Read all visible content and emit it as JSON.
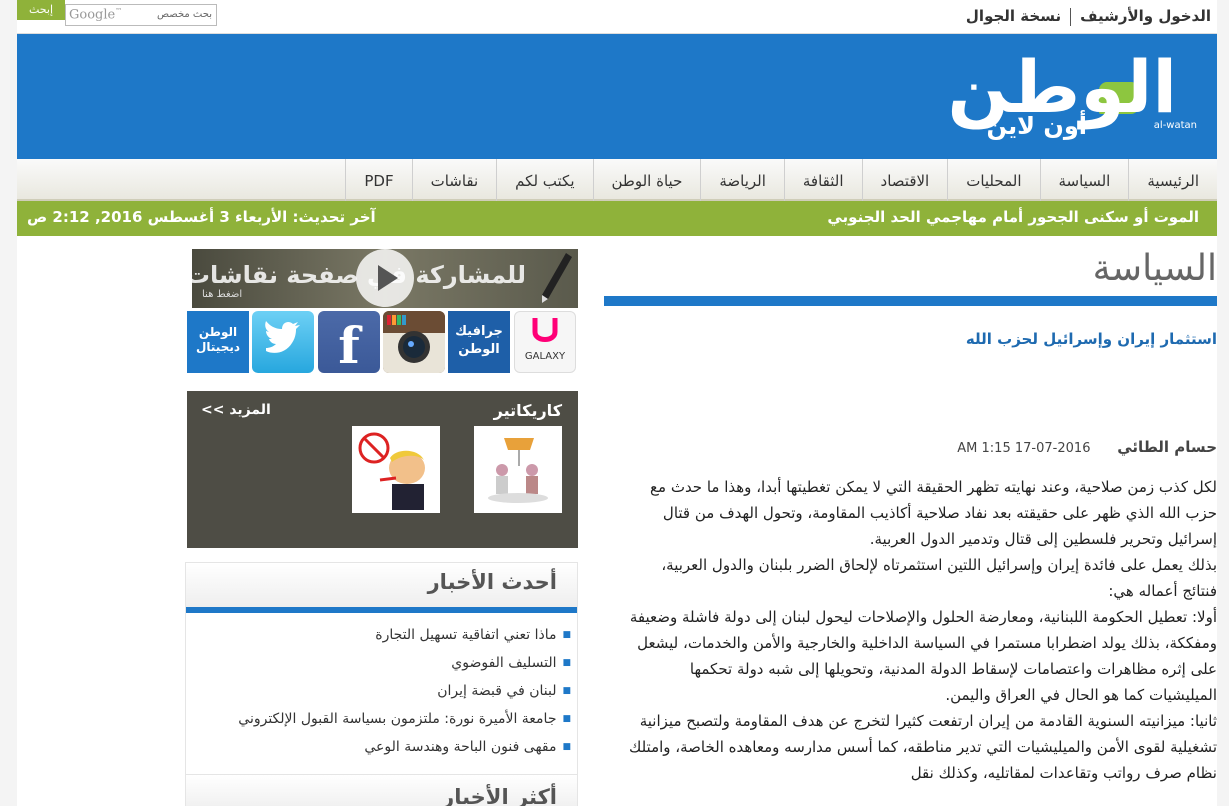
{
  "top": {
    "archive_link": "الدخول والأرشيف",
    "mobile_link": "نسخة الجوال",
    "search_button": "إبحث",
    "search_brand": "Google",
    "search_placeholder": "بحث مخصص"
  },
  "brand": {
    "logo_main": "الوطن",
    "logo_sub": "أون لاين",
    "logo_latin": "al-watan",
    "primary_color": "#1e78c8",
    "accent_color": "#8fb23a"
  },
  "nav": {
    "items": [
      {
        "label": "الرئيسية"
      },
      {
        "label": "السياسة"
      },
      {
        "label": "المحليات"
      },
      {
        "label": "الاقتصاد"
      },
      {
        "label": "الثقافة"
      },
      {
        "label": "الرياضة"
      },
      {
        "label": "حياة الوطن"
      },
      {
        "label": "يكتب لكم"
      },
      {
        "label": "نقاشات"
      },
      {
        "label": "PDF"
      }
    ]
  },
  "ticker": {
    "headline": "الموت أو سكنى الجحور أمام مهاجمي الحد الجنوبي",
    "last_update": "آخر تحديث: الأربعاء 3 أغسطس 2016, 2:12 ص"
  },
  "article": {
    "section": "السياسة",
    "headline": "استثمار إيران وإسرائيل لحزب الله",
    "author": "حسام الطائي",
    "date": "2016-07-17 1:15 AM",
    "paragraphs": [
      "لكل كذب زمن صلاحية، وعند نهايته تظهر الحقيقة التي لا يمكن تغطيتها أبدا، وهذا ما حدث مع حزب الله الذي ظهر على حقيقته بعد نفاد صلاحية أكاذيب المقاومة، وتحول الهدف من قتال إسرائيل وتحرير فلسطين إلى قتال وتدمير الدول العربية.",
      "بذلك يعمل على فائدة إيران وإسرائيل اللتين استثمرتاه لإلحاق الضرر بلبنان والدول العربية، فنتائج أعماله هي:",
      "أولا: تعطيل الحكومة اللبنانية، ومعارضة الحلول والإصلاحات ليحول لبنان إلى دولة فاشلة وضعيفة ومفككة، بذلك يولد اضطرابا مستمرا في السياسة الداخلية والخارجية والأمن والخدمات، ليشعل على إثره مظاهرات واعتصامات لإسقاط الدولة المدنية، وتحويلها إلى شبه دولة تحكمها الميليشيات كما هو الحال في العراق واليمن.",
      "ثانيا: ميزانيته السنوية القادمة من إيران ارتفعت كثيرا لتخرج عن هدف المقاومة ولتصبح ميزانية تشغيلية لقوى الأمن والميليشيات التي تدير مناطقه، كما أسس مدارسه ومعاهده الخاصة، وامتلك نظام صرف رواتب وتقاعدات لمقاتليه، وكذلك نقل"
    ]
  },
  "sidebar": {
    "promo_text": "للمشاركة في صفحة نقاشات",
    "promo_sub": "اضغط هنا",
    "social": {
      "watan_digital": "الوطن ديجيتال",
      "graphic": "جرافيك الوطن",
      "galaxy": "GALAXY"
    },
    "caricature": {
      "title": "كاريكاتير",
      "more": "المزيد >>"
    },
    "latest": {
      "title": "أحدث الأخبار",
      "items": [
        {
          "title": "ماذا تعني اتفاقية تسهيل التجارة"
        },
        {
          "title": "التسليف الفوضوي"
        },
        {
          "title": "لبنان في قبضة إيران"
        },
        {
          "title": "جامعة الأميرة نورة: ملتزمون بسياسة القبول الإلكتروني"
        },
        {
          "title": "مقهى فنون الباحة وهندسة الوعي"
        }
      ]
    },
    "most_read": {
      "title": "أكثر الأخبار"
    }
  }
}
